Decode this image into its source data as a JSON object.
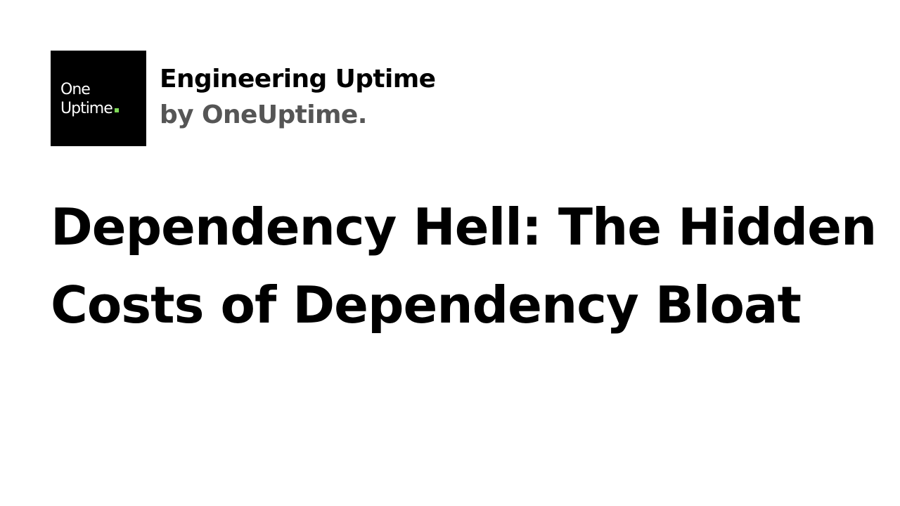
{
  "logo": {
    "line1": "One",
    "line2": "Uptime",
    "dot_color": "#7ed957",
    "background_color": "#000000"
  },
  "brand": {
    "title": "Engineering Uptime",
    "subtitle": "by OneUptime."
  },
  "article": {
    "title": "Dependency Hell: The Hidden Costs of Dependency Bloat"
  }
}
